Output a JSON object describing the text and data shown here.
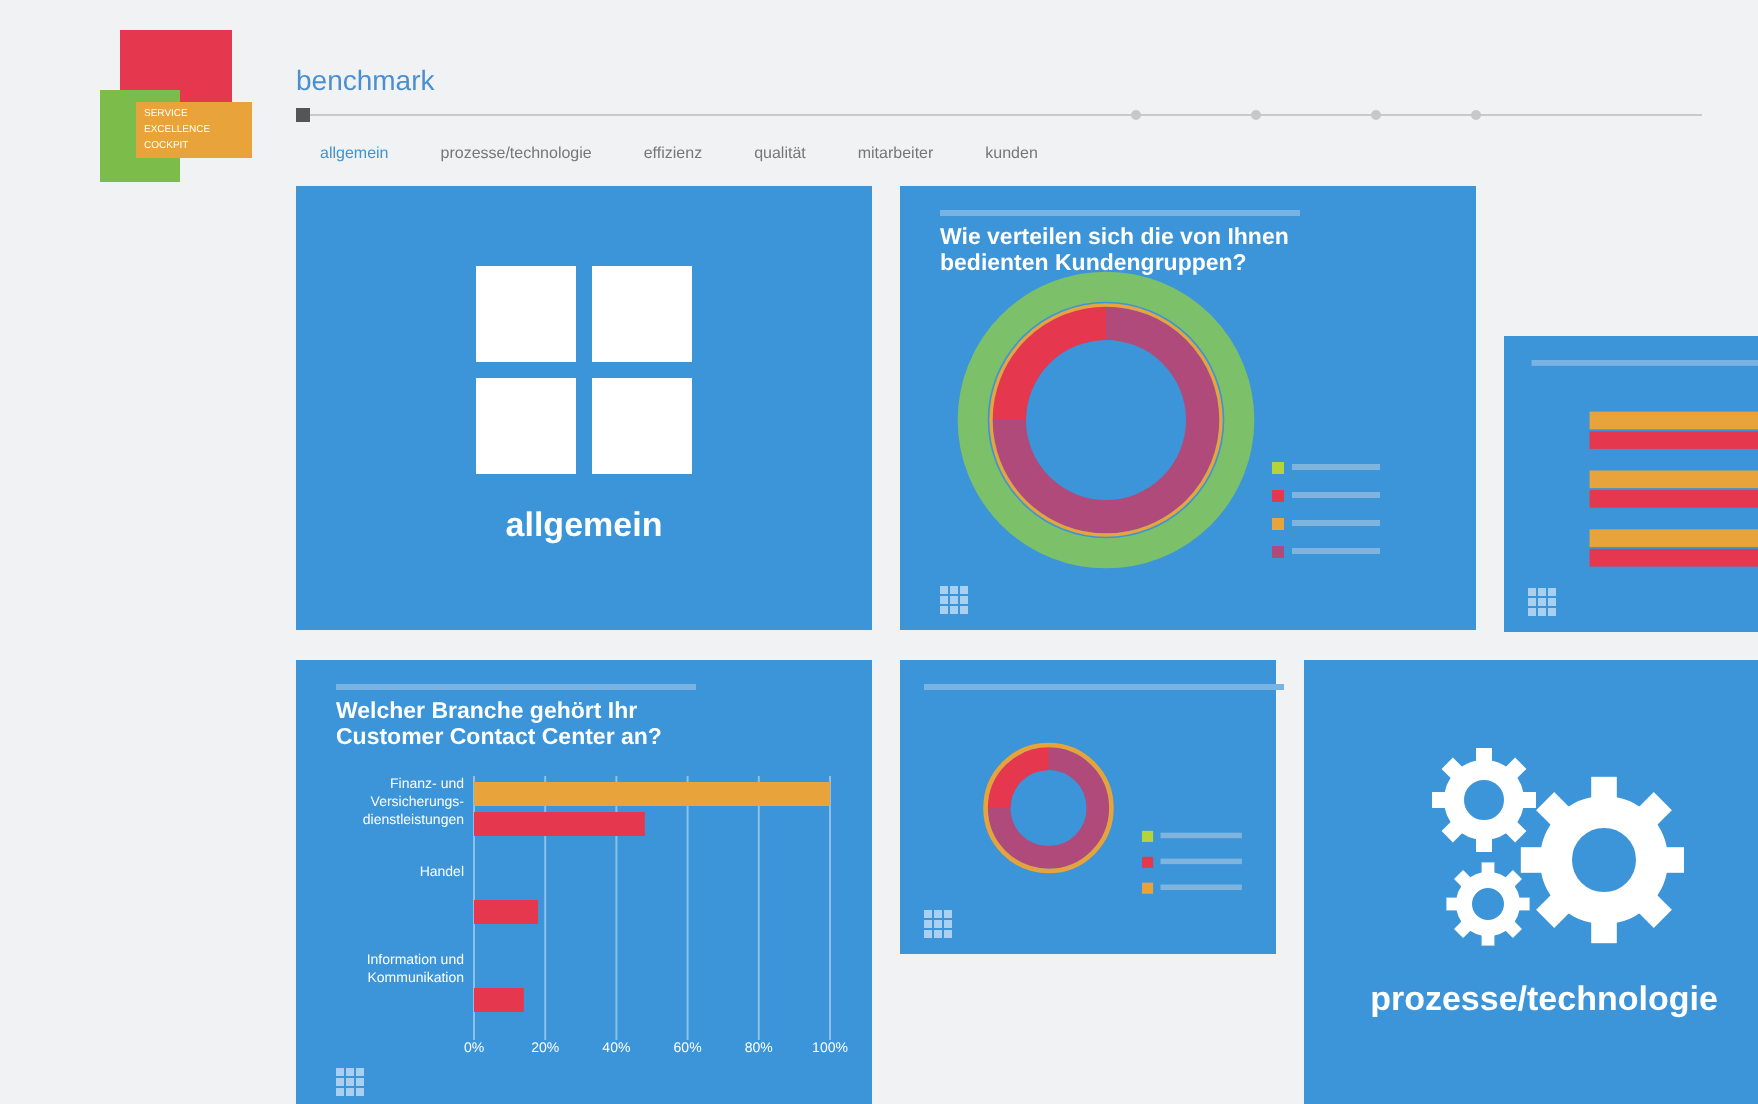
{
  "logo": {
    "lines": [
      "SERVICE",
      "EXCELLENCE",
      "COCKPIT"
    ]
  },
  "header": {
    "title": "benchmark"
  },
  "tabs": [
    {
      "label": "allgemein",
      "selected": true
    },
    {
      "label": "prozesse/technologie",
      "selected": false
    },
    {
      "label": "effizienz",
      "selected": false
    },
    {
      "label": "qualität",
      "selected": false
    },
    {
      "label": "mitarbeiter",
      "selected": false
    },
    {
      "label": "kunden",
      "selected": false
    }
  ],
  "tiles": [
    {
      "kind": "windows",
      "label": "allgemein"
    },
    {
      "kind": "donut",
      "title": "Wie verteilen sich die von Ihnen bedienten Kundengruppen?"
    },
    {
      "kind": "minibars"
    },
    {
      "kind": "bars",
      "title": "Welcher Branche gehört Ihr Customer Contact Center an?",
      "chart_data": {
        "type": "bar",
        "orientation": "horizontal",
        "categories": [
          "Finanz- und Versicherungs-dienstleistungen",
          "Handel",
          "Information und Kommunikation"
        ],
        "series": [
          {
            "color": "#e8a33a",
            "values": [
              100,
              null,
              null
            ]
          },
          {
            "color": "#e5384f",
            "values": [
              48,
              18,
              14
            ]
          }
        ],
        "xlim": [
          0,
          100
        ],
        "grid": true,
        "xticks": [
          {
            "value": 0,
            "label": "0%"
          },
          {
            "value": 20,
            "label": "20%"
          },
          {
            "value": 40,
            "label": "40%"
          },
          {
            "value": 60,
            "label": "60%"
          },
          {
            "value": 80,
            "label": "80%"
          },
          {
            "value": 100,
            "label": "100%"
          }
        ]
      }
    },
    {
      "kind": "smalldonut"
    },
    {
      "kind": "gears",
      "label": "prozesse/technologie"
    }
  ]
}
